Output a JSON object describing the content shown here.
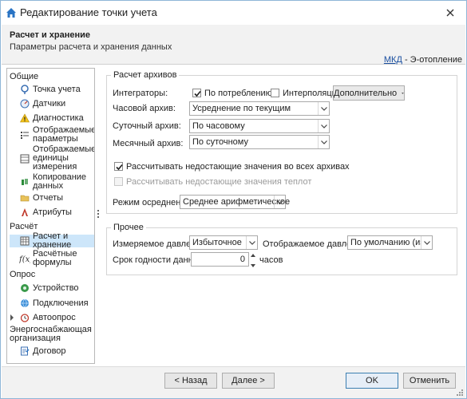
{
  "window": {
    "title": "Редактирование точки учета",
    "close_icon": "close-icon",
    "app_icon": "house-icon"
  },
  "header": {
    "title": "Расчет и хранение",
    "subtitle": "Параметры расчета и хранения данных",
    "link": "МКД",
    "link_suffix": " - Э-отопление"
  },
  "sidebar": {
    "groups": {
      "general": "Общие",
      "calc": "Расчёт",
      "poll": "Опрос"
    },
    "items": [
      {
        "label": "Точка учета",
        "icon": "pin-icon"
      },
      {
        "label": "Датчики",
        "icon": "gauge-icon"
      },
      {
        "label": "Диагностика",
        "icon": "warning-icon"
      },
      {
        "label": "Отображаемые параметры",
        "icon": "list-icon"
      },
      {
        "label": "Отображаемые единицы измерения",
        "icon": "units-icon"
      },
      {
        "label": "Копирование данных",
        "icon": "copy-icon"
      },
      {
        "label": "Отчеты",
        "icon": "folder-icon"
      },
      {
        "label": "Атрибуты",
        "icon": "attributes-icon"
      },
      {
        "label": "Расчет и хранение",
        "icon": "table-icon"
      },
      {
        "label": "Расчётные формулы",
        "icon": "formula-icon"
      },
      {
        "label": "Устройство",
        "icon": "device-icon"
      },
      {
        "label": "Подключения",
        "icon": "globe-icon"
      },
      {
        "label": "Автоопрос",
        "icon": "alarm-icon"
      },
      {
        "label": "Энергоснабжающая организация",
        "icon": ""
      },
      {
        "label": "Договор",
        "icon": "contract-icon"
      }
    ]
  },
  "archive_calc": {
    "legend": "Расчет архивов",
    "integrators_label": "Интеграторы:",
    "by_consumption_label": "По потреблению",
    "by_consumption_checked": true,
    "interpolation_label": "Интерполяция",
    "interpolation_checked": false,
    "more_button": "Дополнительно",
    "hourly_label": "Часовой архив:",
    "hourly_value": "Усреднение по текущим",
    "daily_label": "Суточный архив:",
    "daily_value": "По часовому",
    "monthly_label": "Месячный архив:",
    "monthly_value": "По суточному",
    "calc_missing_label": "Рассчитывать недостающие значения во всех архивах",
    "calc_missing_checked": true,
    "calc_missing_heat_label": "Рассчитывать недостающие значения теплот",
    "calc_missing_heat_checked": false,
    "avg_mode_label": "Режим осреднения:",
    "avg_mode_value": "Среднее арифметическое"
  },
  "other": {
    "legend": "Прочее",
    "measured_pressure_label": "Измеряемое давление:",
    "measured_pressure_value": "Избыточное",
    "displayed_pressure_label": "Отображаемое давление:",
    "displayed_pressure_value": "По умолчанию (из с...",
    "shelf_life_label": "Срок годности данных:",
    "shelf_life_value": "0",
    "shelf_life_unit": "часов"
  },
  "footer": {
    "back": "< Назад",
    "next": "Далее >",
    "ok": "OK",
    "cancel": "Отменить"
  }
}
